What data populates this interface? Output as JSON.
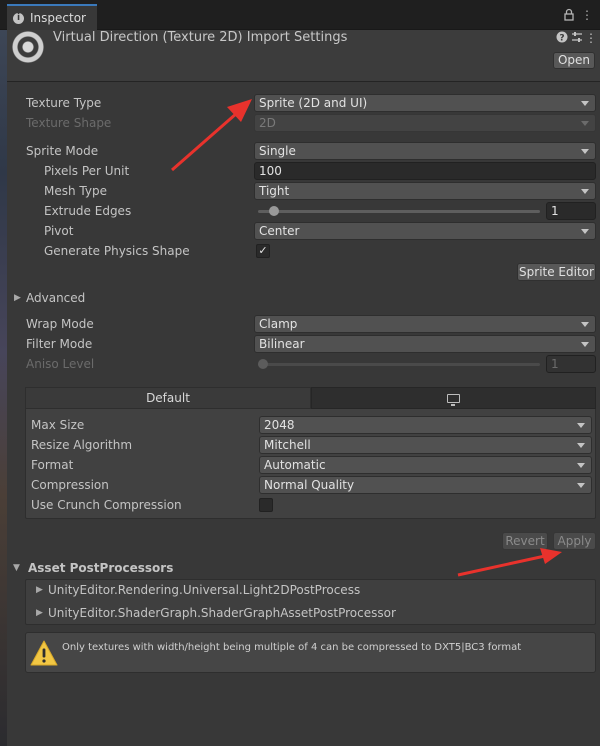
{
  "window": {
    "tab_title": "Inspector",
    "asset_title": "Virtual Direction (Texture 2D) Import Settings",
    "open_button": "Open",
    "icons": [
      "info-icon",
      "lock-icon",
      "menu-icon",
      "help-icon",
      "settings-sliders-icon",
      "more-icon"
    ]
  },
  "properties": {
    "texture_type": {
      "label": "Texture Type",
      "value": "Sprite (2D and UI)"
    },
    "texture_shape": {
      "label": "Texture Shape",
      "value": "2D"
    },
    "sprite_mode": {
      "label": "Sprite Mode",
      "value": "Single"
    },
    "pixels_per_unit": {
      "label": "Pixels Per Unit",
      "value": "100"
    },
    "mesh_type": {
      "label": "Mesh Type",
      "value": "Tight"
    },
    "extrude_edges": {
      "label": "Extrude Edges",
      "value": "1",
      "level": 0.04
    },
    "pivot": {
      "label": "Pivot",
      "value": "Center"
    },
    "generate_physics_shape": {
      "label": "Generate Physics Shape",
      "checked": true,
      "check_glyph": "✓"
    },
    "sprite_editor_button": "Sprite Editor"
  },
  "advanced": {
    "label": "Advanced",
    "fold_glyph": "▶"
  },
  "wrap": {
    "wrap_mode": {
      "label": "Wrap Mode",
      "value": "Clamp"
    },
    "filter_mode": {
      "label": "Filter Mode",
      "value": "Bilinear"
    },
    "aniso_level": {
      "label": "Aniso Level",
      "value": "1",
      "level": 0.0
    }
  },
  "platform": {
    "tabs": [
      "Default",
      "monitor-icon"
    ],
    "max_size": {
      "label": "Max Size",
      "value": "2048"
    },
    "resize_algorithm": {
      "label": "Resize Algorithm",
      "value": "Mitchell"
    },
    "format": {
      "label": "Format",
      "value": "Automatic"
    },
    "compression": {
      "label": "Compression",
      "value": "Normal Quality"
    },
    "use_crunch": {
      "label": "Use Crunch Compression",
      "checked": false
    }
  },
  "actions": {
    "revert": "Revert",
    "apply": "Apply"
  },
  "post_processors": {
    "title": "Asset PostProcessors",
    "fold_open_glyph": "▼",
    "item_glyph": "▶",
    "items": [
      "UnityEditor.Rendering.Universal.Light2DPostProcess",
      "UnityEditor.ShaderGraph.ShaderGraphAssetPostProcessor"
    ]
  },
  "warning": {
    "text": "Only textures with width/height being multiple of 4 can be compressed to DXT5|BC3 format",
    "icon": "warning-icon"
  },
  "colors": {
    "panel": "#383838",
    "accent_tab": "#3a79bb",
    "annotation_arrow": "#e8322c",
    "warning_yellow": "#f2c744"
  }
}
